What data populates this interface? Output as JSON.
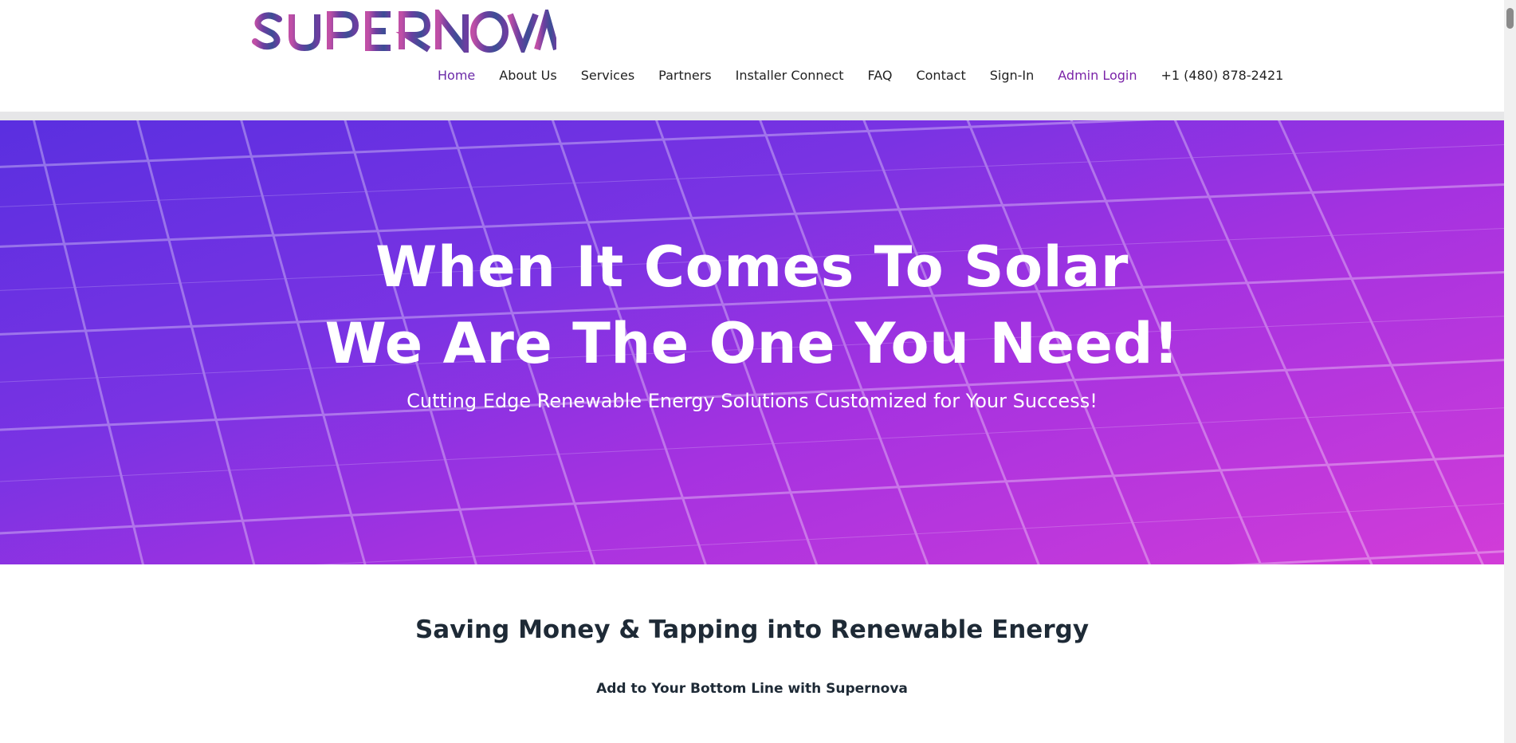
{
  "brand": {
    "logo_text": "SUPERNOVA",
    "logo_colors": [
      "#c04fa6",
      "#6a3fa0",
      "#3c4e95",
      "#6c3ea0"
    ]
  },
  "nav": {
    "items": [
      {
        "label": "Home",
        "active": true
      },
      {
        "label": "About Us"
      },
      {
        "label": "Services"
      },
      {
        "label": "Partners"
      },
      {
        "label": "Installer Connect"
      },
      {
        "label": "FAQ"
      },
      {
        "label": "Contact"
      },
      {
        "label": "Sign-In"
      },
      {
        "label": "Admin Login"
      },
      {
        "label": "+1 (480) 878-2421"
      }
    ]
  },
  "hero": {
    "title_line1": "When It Comes To Solar",
    "title_line2": "We Are The One You Need!",
    "subtitle": "Cutting Edge Renewable Energy Solutions Customized for Your Success!",
    "gradient_colors": [
      "#5a2fe0",
      "#7a33e3",
      "#a532e0",
      "#d23cd8"
    ]
  },
  "content": {
    "heading": "Saving Money & Tapping into Renewable Energy",
    "subheading": "Add to Your Bottom Line with Supernova"
  },
  "icons": [
    "solar-panel-background-icon",
    "scrollbar-thumb"
  ]
}
